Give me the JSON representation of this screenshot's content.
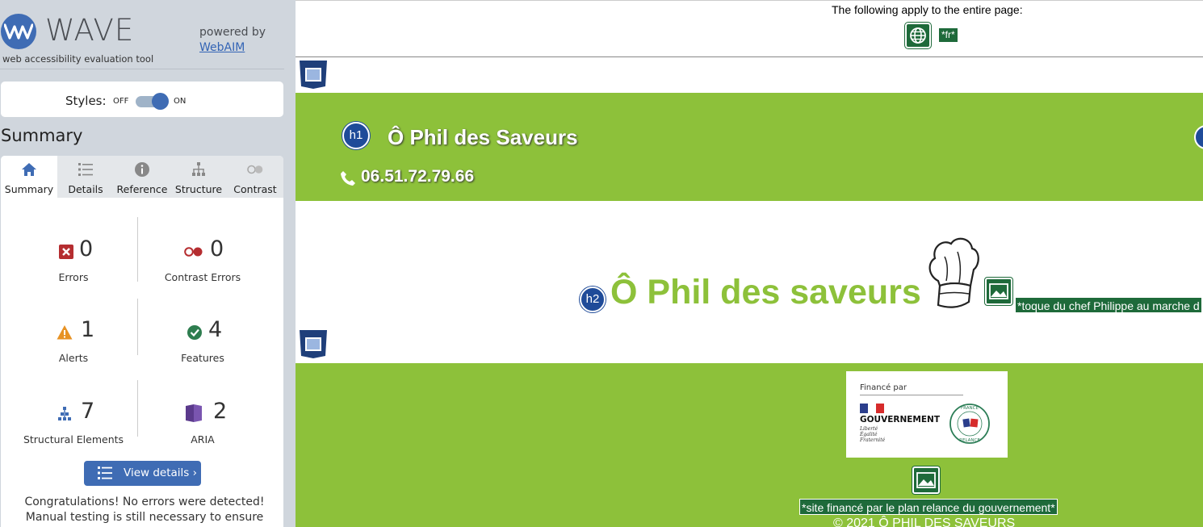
{
  "sidebar": {
    "logo_word": "WAVE",
    "tagline": "web accessibility evaluation tool",
    "powered_by": "powered by",
    "webaim_link": "WebAIM",
    "styles": {
      "label": "Styles:",
      "off": "OFF",
      "on": "ON",
      "state": "on"
    },
    "summary_heading": "Summary",
    "tabs": [
      {
        "label": "Summary",
        "icon": "home-icon",
        "active": true
      },
      {
        "label": "Details",
        "icon": "list-icon",
        "active": false
      },
      {
        "label": "Reference",
        "icon": "info-icon",
        "active": false
      },
      {
        "label": "Structure",
        "icon": "hierarchy-icon",
        "active": false
      },
      {
        "label": "Contrast",
        "icon": "contrast-icon",
        "active": false
      }
    ],
    "stats": {
      "errors": {
        "count": "0",
        "label": "Errors",
        "color": "#b52d30"
      },
      "contrast_errors": {
        "count": "0",
        "label": "Contrast Errors",
        "color": "#b52d30"
      },
      "alerts": {
        "count": "1",
        "label": "Alerts",
        "color": "#e79224"
      },
      "features": {
        "count": "4",
        "label": "Features",
        "color": "#2e7d4f"
      },
      "structural": {
        "count": "7",
        "label": "Structural Elements",
        "color": "#3f6cb4"
      },
      "aria": {
        "count": "2",
        "label": "ARIA",
        "color": "#5b3a8c"
      }
    },
    "view_details": "View details ›",
    "congrats": "Congratulations! No errors were detected! Manual testing is still necessary to ensure compliance and"
  },
  "page": {
    "banner_text": "The following apply to the entire page:",
    "lang_badge": "*fr*",
    "h1_badge": "h1",
    "site_title": "Ô Phil des Saveurs",
    "phone": "06.51.72.79.66",
    "h2_badge": "h2",
    "h2_text": "Ô Phil des saveurs",
    "toque_alt": "*toque du chef Philippe au marche d",
    "gov_logo": {
      "finance": "Financé par",
      "name": "GOUVERNEMENT",
      "motto": [
        "Liberté",
        "Égalité",
        "Fraternité"
      ],
      "seal": "FRANCE RELANCE"
    },
    "gov_alt": "*site financé par le plan relance du gouvernement*",
    "copyright": "© 2021 Ô PHIL DES SAVEURS"
  },
  "colors": {
    "accent": "#3f6cb4",
    "page_green": "#8dc13a",
    "wave_feature_green": "#1e6a3a",
    "heading_badge": "#1f4b99"
  }
}
